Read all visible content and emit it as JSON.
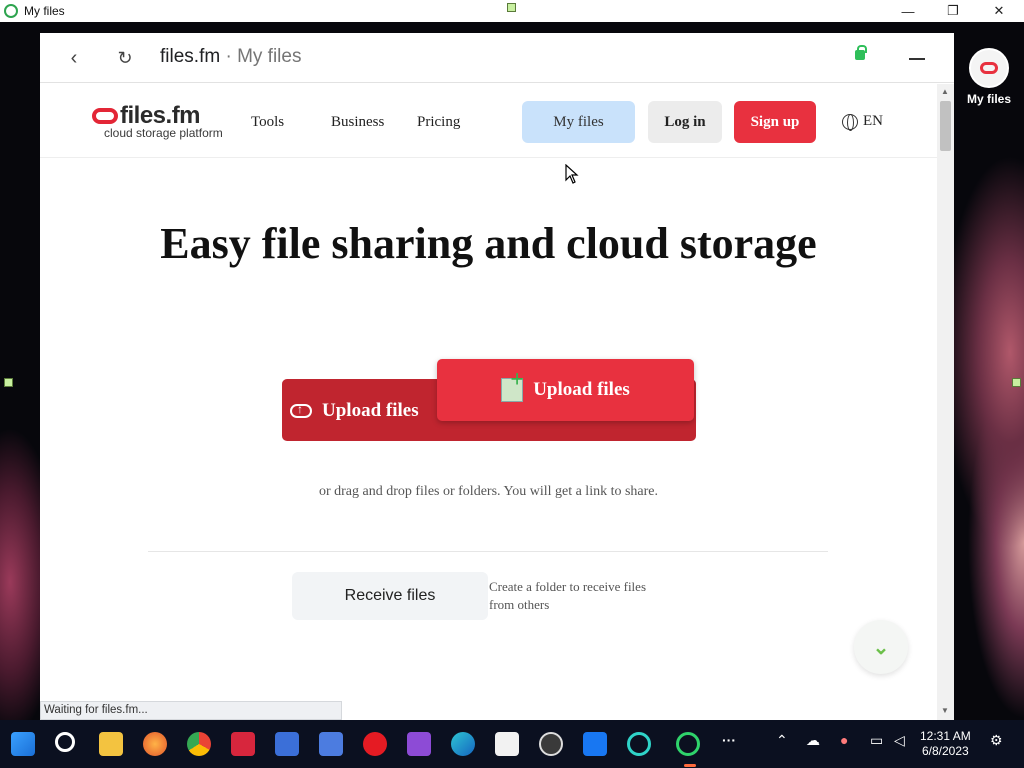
{
  "window": {
    "title": "My files"
  },
  "side_app": {
    "label": "My files"
  },
  "browser": {
    "url_host": "files.fm",
    "url_sep": " · ",
    "url_page": "My files"
  },
  "site": {
    "logo_name": "files.fm",
    "logo_tagline": "cloud storage platform",
    "nav": [
      "Tools",
      "Business",
      "Pricing"
    ],
    "my_files_label": "My files",
    "login_label": "Log in",
    "signup_label": "Sign up",
    "language": "EN",
    "headline": "Easy file sharing and cloud storage",
    "upload_label": "Upload files",
    "upload_drag_label": "Upload files",
    "drag_hint": "or drag and drop files or folders. You will get a link to share.",
    "receive_label": "Receive files",
    "receive_desc": "Create a folder to receive files from others"
  },
  "status_text": "Waiting for files.fm...",
  "taskbar": {
    "icons": [
      "start-icon",
      "search-icon",
      "file-explorer-icon",
      "firefox-icon",
      "chrome-icon",
      "screen-recorder-icon",
      "p-app-icon",
      "p-app-icon-2",
      "opera-icon",
      "clapper-icon",
      "edge-icon",
      "photos-icon",
      "media-player-icon",
      "facebook-icon",
      "circle-app-icon",
      "circle-app-active-icon",
      "more-icon"
    ],
    "time": "12:31 AM",
    "date": "6/8/2023"
  },
  "colors": {
    "brand_red": "#e8313f",
    "my_files_blue": "#c9e2fb",
    "taskbar": "#0b1020"
  }
}
